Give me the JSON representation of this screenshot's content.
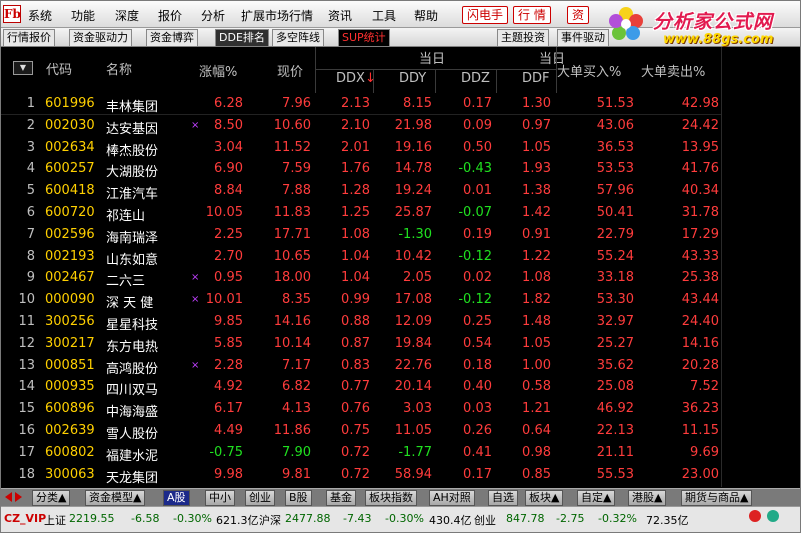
{
  "menu": {
    "logo": "Fb",
    "items": [
      "系统",
      "功能",
      "深度",
      "报价",
      "分析",
      "扩展市场行情",
      "资讯",
      "工具",
      "帮助"
    ],
    "buttons": [
      "闪电手",
      "行 情",
      "资"
    ]
  },
  "brand": {
    "title": "分析家公式网",
    "url": "www.88gs.com"
  },
  "tabs": [
    "行情报价",
    "资金驱动力",
    "资金博弈",
    "DDE排名",
    "多空阵线",
    "SUP统计",
    "主题投资",
    "事件驱动"
  ],
  "header": {
    "group1": "当日",
    "group2": "当日",
    "cols": {
      "code": "代码",
      "name": "名称",
      "change": "涨幅%",
      "price": "现价",
      "ddx": "DDX",
      "ddx_sort": "↓",
      "ddy": "DDY",
      "ddz": "DDZ",
      "ddf": "DDF",
      "bigbuy": "大单买入%",
      "bigsell": "大单卖出%"
    },
    "menu_glyph": "▼"
  },
  "rows": [
    {
      "i": "1",
      "code": "601996",
      "name": "丰林集团",
      "mark": "",
      "chg": "6.28",
      "price": "7.96",
      "ddx": "2.13",
      "ddy": "8.15",
      "ddz": "0.17",
      "ddf": "1.30",
      "buy": "51.53",
      "sell": "42.98",
      "cc": "red",
      "pc": "red",
      "zc": "red"
    },
    {
      "i": "2",
      "code": "002030",
      "name": "达安基因",
      "mark": "×",
      "chg": "8.50",
      "price": "10.60",
      "ddx": "2.10",
      "ddy": "21.98",
      "ddz": "0.09",
      "ddf": "0.97",
      "buy": "43.06",
      "sell": "24.42",
      "cc": "red",
      "pc": "red",
      "zc": "red"
    },
    {
      "i": "3",
      "code": "002634",
      "name": "棒杰股份",
      "mark": "",
      "chg": "3.04",
      "price": "11.52",
      "ddx": "2.01",
      "ddy": "19.16",
      "ddz": "0.50",
      "ddf": "1.05",
      "buy": "36.53",
      "sell": "13.95",
      "cc": "red",
      "pc": "red",
      "zc": "red"
    },
    {
      "i": "4",
      "code": "600257",
      "name": "大湖股份",
      "mark": "",
      "chg": "6.90",
      "price": "7.59",
      "ddx": "1.76",
      "ddy": "14.78",
      "ddz": "-0.43",
      "ddf": "1.93",
      "buy": "53.53",
      "sell": "41.76",
      "cc": "red",
      "pc": "red",
      "zc": "green"
    },
    {
      "i": "5",
      "code": "600418",
      "name": "江淮汽车",
      "mark": "",
      "chg": "8.84",
      "price": "7.88",
      "ddx": "1.28",
      "ddy": "19.24",
      "ddz": "0.01",
      "ddf": "1.38",
      "buy": "57.96",
      "sell": "40.34",
      "cc": "red",
      "pc": "red",
      "zc": "red"
    },
    {
      "i": "6",
      "code": "600720",
      "name": "祁连山",
      "mark": "",
      "chg": "10.05",
      "price": "11.83",
      "ddx": "1.25",
      "ddy": "25.87",
      "ddz": "-0.07",
      "ddf": "1.42",
      "buy": "50.41",
      "sell": "31.78",
      "cc": "red",
      "pc": "red",
      "zc": "green"
    },
    {
      "i": "7",
      "code": "002596",
      "name": "海南瑞泽",
      "mark": "",
      "chg": "2.25",
      "price": "17.71",
      "ddx": "1.08",
      "ddy": "-1.30",
      "ddz": "0.19",
      "ddf": "0.91",
      "buy": "22.79",
      "sell": "17.29",
      "cc": "red",
      "pc": "red",
      "zc": "red",
      "yc": "green"
    },
    {
      "i": "8",
      "code": "002193",
      "name": "山东如意",
      "mark": "",
      "chg": "2.70",
      "price": "10.65",
      "ddx": "1.04",
      "ddy": "10.42",
      "ddz": "-0.12",
      "ddf": "1.22",
      "buy": "55.24",
      "sell": "43.33",
      "cc": "red",
      "pc": "red",
      "zc": "green"
    },
    {
      "i": "9",
      "code": "002467",
      "name": "二六三",
      "mark": "×",
      "chg": "0.95",
      "price": "18.00",
      "ddx": "1.04",
      "ddy": "2.05",
      "ddz": "0.02",
      "ddf": "1.08",
      "buy": "33.18",
      "sell": "25.38",
      "cc": "red",
      "pc": "red",
      "zc": "red"
    },
    {
      "i": "10",
      "code": "000090",
      "name": "深 天 健",
      "mark": "×",
      "chg": "10.01",
      "price": "8.35",
      "ddx": "0.99",
      "ddy": "17.08",
      "ddz": "-0.12",
      "ddf": "1.82",
      "buy": "53.30",
      "sell": "43.44",
      "cc": "red",
      "pc": "red",
      "zc": "green"
    },
    {
      "i": "11",
      "code": "300256",
      "name": "星星科技",
      "mark": "",
      "chg": "9.85",
      "price": "14.16",
      "ddx": "0.88",
      "ddy": "12.09",
      "ddz": "0.25",
      "ddf": "1.48",
      "buy": "32.97",
      "sell": "24.40",
      "cc": "red",
      "pc": "red",
      "zc": "red"
    },
    {
      "i": "12",
      "code": "300217",
      "name": "东方电热",
      "mark": "",
      "chg": "5.85",
      "price": "10.14",
      "ddx": "0.87",
      "ddy": "19.84",
      "ddz": "0.54",
      "ddf": "1.05",
      "buy": "25.27",
      "sell": "14.16",
      "cc": "red",
      "pc": "red",
      "zc": "red"
    },
    {
      "i": "13",
      "code": "000851",
      "name": "高鸿股份",
      "mark": "×",
      "chg": "2.28",
      "price": "7.17",
      "ddx": "0.83",
      "ddy": "22.76",
      "ddz": "0.18",
      "ddf": "1.00",
      "buy": "35.62",
      "sell": "20.28",
      "cc": "red",
      "pc": "red",
      "zc": "red"
    },
    {
      "i": "14",
      "code": "000935",
      "name": "四川双马",
      "mark": "",
      "chg": "4.92",
      "price": "6.82",
      "ddx": "0.77",
      "ddy": "20.14",
      "ddz": "0.40",
      "ddf": "0.58",
      "buy": "25.08",
      "sell": "7.52",
      "cc": "red",
      "pc": "red",
      "zc": "red"
    },
    {
      "i": "15",
      "code": "600896",
      "name": "中海海盛",
      "mark": "",
      "chg": "6.17",
      "price": "4.13",
      "ddx": "0.76",
      "ddy": "3.03",
      "ddz": "0.03",
      "ddf": "1.21",
      "buy": "46.92",
      "sell": "36.23",
      "cc": "red",
      "pc": "red",
      "zc": "red"
    },
    {
      "i": "16",
      "code": "002639",
      "name": "雪人股份",
      "mark": "",
      "chg": "4.49",
      "price": "11.86",
      "ddx": "0.75",
      "ddy": "11.05",
      "ddz": "0.26",
      "ddf": "0.64",
      "buy": "22.13",
      "sell": "11.15",
      "cc": "red",
      "pc": "red",
      "zc": "red"
    },
    {
      "i": "17",
      "code": "600802",
      "name": "福建水泥",
      "mark": "",
      "chg": "-0.75",
      "price": "7.90",
      "ddx": "0.72",
      "ddy": "-1.77",
      "ddz": "0.41",
      "ddf": "0.98",
      "buy": "21.11",
      "sell": "9.69",
      "cc": "green",
      "pc": "green",
      "zc": "red",
      "yc": "green"
    },
    {
      "i": "18",
      "code": "300063",
      "name": "天龙集团",
      "mark": "",
      "chg": "9.98",
      "price": "9.81",
      "ddx": "0.72",
      "ddy": "58.94",
      "ddz": "0.17",
      "ddf": "0.85",
      "buy": "55.53",
      "sell": "23.00",
      "cc": "red",
      "pc": "red",
      "zc": "red"
    }
  ],
  "bottom_tabs": [
    "分类▲",
    "资金模型▲",
    "A股",
    "中小",
    "创业",
    "B股",
    "基金",
    "板块指数",
    "AH对照",
    "自选",
    "板块▲",
    "自定▲",
    "港股▲",
    "期货与商品▲"
  ],
  "status": {
    "user": "CZ_VIP",
    "sh_label": "上证",
    "sh_value": "2219.55",
    "sh_change": "-6.58",
    "sh_pct": "-0.30%",
    "sh_vol": "621.3亿",
    "sz_label": "沪深",
    "sz_value": "2477.88",
    "sz_change": "-7.43",
    "sz_pct": "-0.30%",
    "sz_vol": "430.4亿",
    "cy_label": "创业",
    "cy_value": "847.78",
    "cy_change": "-2.75",
    "cy_pct": "-0.32%",
    "cy_vol": "72.35亿"
  },
  "colors": {
    "up": "#ff3c3c",
    "down": "#20e020",
    "code": "#ffd000",
    "brand": "#e21a4f"
  }
}
